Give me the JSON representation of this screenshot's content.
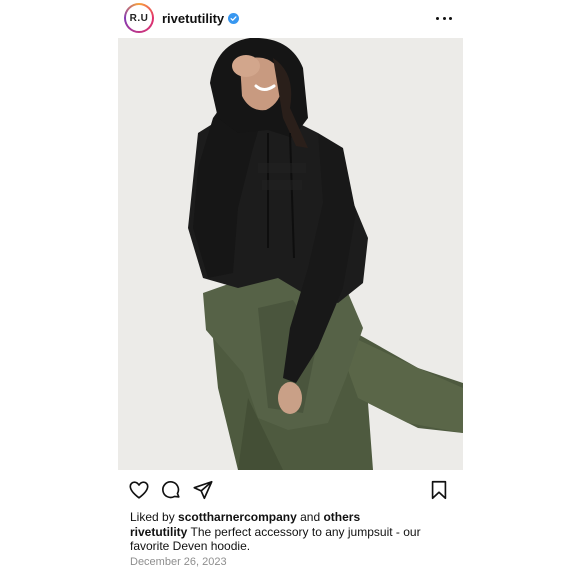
{
  "post": {
    "avatar_text": "R.U",
    "username": "rivetutility",
    "verified_icon": "verified-badge-icon",
    "more_icon": "more-options-icon",
    "image_alt": "Model wearing black Deven hoodie with green jumpsuit tied at waist",
    "actions": {
      "like_icon": "heart-icon",
      "comment_icon": "comment-icon",
      "share_icon": "share-icon",
      "save_icon": "bookmark-icon"
    },
    "likes": {
      "prefix": "Liked by",
      "user": "scottharnercompany",
      "joiner": "and",
      "others": "others"
    },
    "caption": {
      "username": "rivetutility",
      "text": "The perfect accessory to any jumpsuit - our favorite Deven hoodie."
    },
    "date": "December 26, 2023"
  },
  "colors": {
    "verified": "#3897f0",
    "background": "#ffffff",
    "muted_text": "#8e8e8e"
  }
}
